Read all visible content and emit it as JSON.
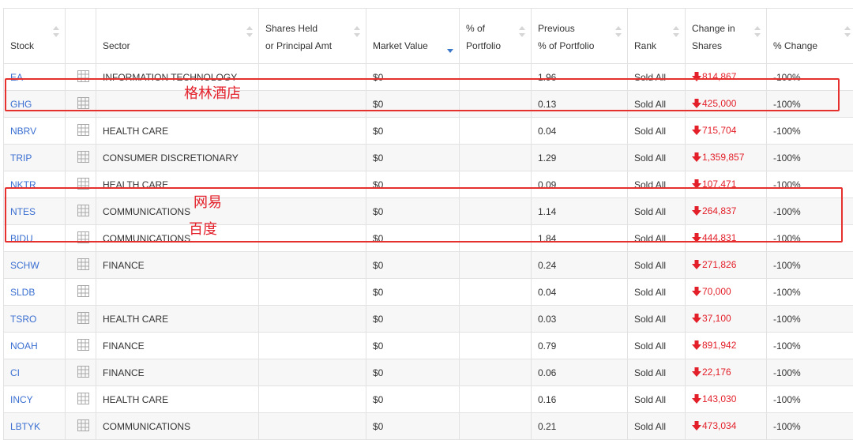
{
  "table": {
    "headers": {
      "stock": "Stock",
      "sector": "Sector",
      "shares_line1": "Shares Held",
      "shares_line2": "or Principal Amt",
      "market_value": "Market Value",
      "pct_line1": "% of",
      "pct_line2": "Portfolio",
      "prev_line1": "Previous",
      "prev_line2": "% of Portfolio",
      "rank": "Rank",
      "change_line1": "Change in",
      "change_line2": "Shares",
      "pct_change": "% Change"
    },
    "rows": [
      {
        "stock": "EA",
        "sector": "INFORMATION TECHNOLOGY",
        "shares": "",
        "market_value": "$0",
        "pct_portfolio": "",
        "prev_pct": "1.96",
        "rank": "Sold All",
        "change": "814,867",
        "pct_change": "-100%"
      },
      {
        "stock": "GHG",
        "sector": "",
        "shares": "",
        "market_value": "$0",
        "pct_portfolio": "",
        "prev_pct": "0.13",
        "rank": "Sold All",
        "change": "425,000",
        "pct_change": "-100%"
      },
      {
        "stock": "NBRV",
        "sector": "HEALTH CARE",
        "shares": "",
        "market_value": "$0",
        "pct_portfolio": "",
        "prev_pct": "0.04",
        "rank": "Sold All",
        "change": "715,704",
        "pct_change": "-100%"
      },
      {
        "stock": "TRIP",
        "sector": "CONSUMER DISCRETIONARY",
        "shares": "",
        "market_value": "$0",
        "pct_portfolio": "",
        "prev_pct": "1.29",
        "rank": "Sold All",
        "change": "1,359,857",
        "pct_change": "-100%"
      },
      {
        "stock": "NKTR",
        "sector": "HEALTH CARE",
        "shares": "",
        "market_value": "$0",
        "pct_portfolio": "",
        "prev_pct": "0.09",
        "rank": "Sold All",
        "change": "107,471",
        "pct_change": "-100%"
      },
      {
        "stock": "NTES",
        "sector": "COMMUNICATIONS",
        "shares": "",
        "market_value": "$0",
        "pct_portfolio": "",
        "prev_pct": "1.14",
        "rank": "Sold All",
        "change": "264,837",
        "pct_change": "-100%"
      },
      {
        "stock": "BIDU",
        "sector": "COMMUNICATIONS",
        "shares": "",
        "market_value": "$0",
        "pct_portfolio": "",
        "prev_pct": "1.84",
        "rank": "Sold All",
        "change": "444,831",
        "pct_change": "-100%"
      },
      {
        "stock": "SCHW",
        "sector": "FINANCE",
        "shares": "",
        "market_value": "$0",
        "pct_portfolio": "",
        "prev_pct": "0.24",
        "rank": "Sold All",
        "change": "271,826",
        "pct_change": "-100%"
      },
      {
        "stock": "SLDB",
        "sector": "",
        "shares": "",
        "market_value": "$0",
        "pct_portfolio": "",
        "prev_pct": "0.04",
        "rank": "Sold All",
        "change": "70,000",
        "pct_change": "-100%"
      },
      {
        "stock": "TSRO",
        "sector": "HEALTH CARE",
        "shares": "",
        "market_value": "$0",
        "pct_portfolio": "",
        "prev_pct": "0.03",
        "rank": "Sold All",
        "change": "37,100",
        "pct_change": "-100%"
      },
      {
        "stock": "NOAH",
        "sector": "FINANCE",
        "shares": "",
        "market_value": "$0",
        "pct_portfolio": "",
        "prev_pct": "0.79",
        "rank": "Sold All",
        "change": "891,942",
        "pct_change": "-100%"
      },
      {
        "stock": "CI",
        "sector": "FINANCE",
        "shares": "",
        "market_value": "$0",
        "pct_portfolio": "",
        "prev_pct": "0.06",
        "rank": "Sold All",
        "change": "22,176",
        "pct_change": "-100%"
      },
      {
        "stock": "INCY",
        "sector": "HEALTH CARE",
        "shares": "",
        "market_value": "$0",
        "pct_portfolio": "",
        "prev_pct": "0.16",
        "rank": "Sold All",
        "change": "143,030",
        "pct_change": "-100%"
      },
      {
        "stock": "LBTYK",
        "sector": "COMMUNICATIONS",
        "shares": "",
        "market_value": "$0",
        "pct_portfolio": "",
        "prev_pct": "0.21",
        "rank": "Sold All",
        "change": "473,034",
        "pct_change": "-100%"
      }
    ],
    "sorted_column": "market_value",
    "sort_direction": "descending"
  },
  "annotations": {
    "ghg_note": "格林酒店",
    "ntes_note": "网易",
    "bidu_note": "百度"
  },
  "colors": {
    "link": "#3a6fd1",
    "decrease": "#e3202a",
    "annotation": "#e5302e",
    "sort_active": "#3a77c9"
  },
  "icons": {
    "row_detail": "grid-icon",
    "change_direction": "down-arrow-icon"
  }
}
